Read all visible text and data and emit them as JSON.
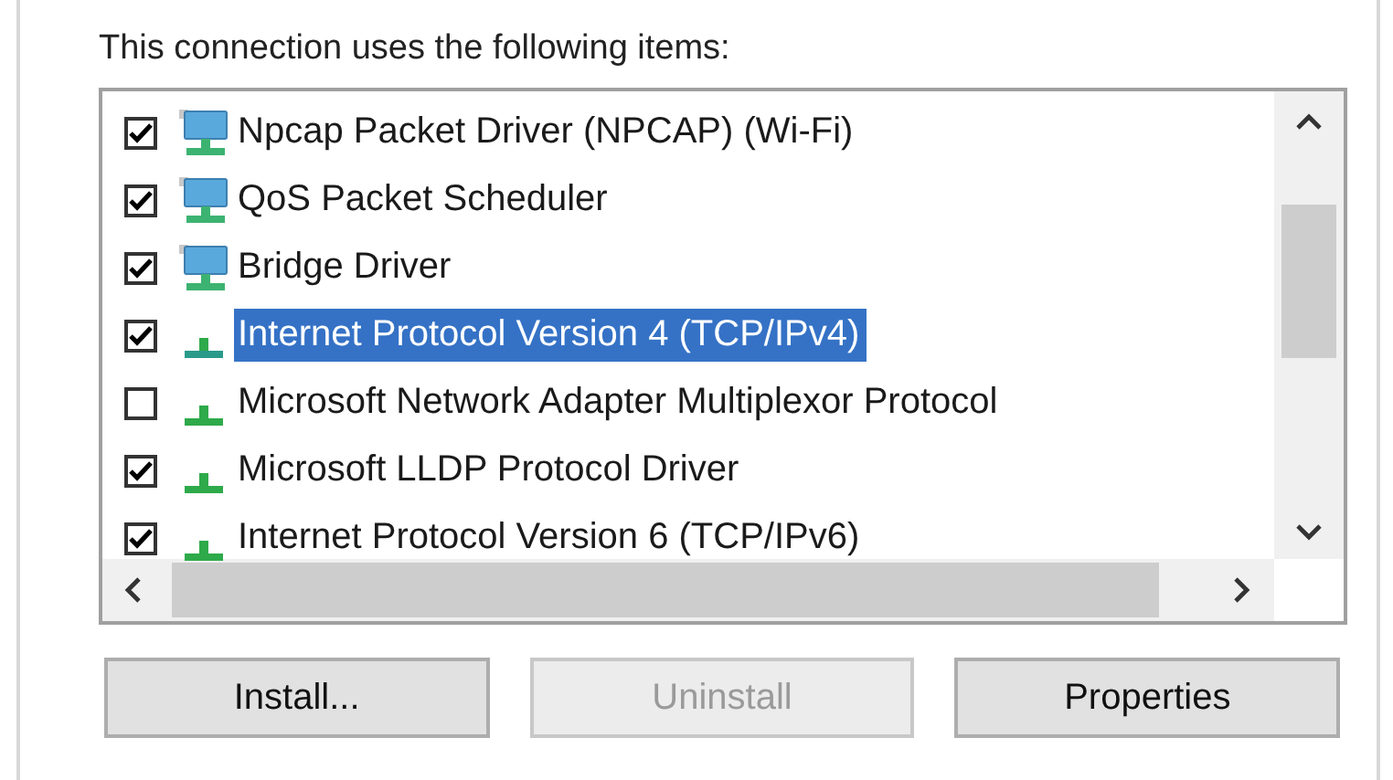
{
  "heading": "This connection uses the following items:",
  "items": [
    {
      "label": "Npcap Packet Driver (NPCAP) (Wi-Fi)",
      "checked": true,
      "selected": false,
      "kind": "service"
    },
    {
      "label": "QoS Packet Scheduler",
      "checked": true,
      "selected": false,
      "kind": "service"
    },
    {
      "label": "Bridge Driver",
      "checked": true,
      "selected": false,
      "kind": "service"
    },
    {
      "label": "Internet Protocol Version 4 (TCP/IPv4)",
      "checked": true,
      "selected": true,
      "kind": "protocol"
    },
    {
      "label": "Microsoft Network Adapter Multiplexor Protocol",
      "checked": false,
      "selected": false,
      "kind": "protocol"
    },
    {
      "label": "Microsoft LLDP Protocol Driver",
      "checked": true,
      "selected": false,
      "kind": "protocol"
    },
    {
      "label": "Internet Protocol Version 6 (TCP/IPv6)",
      "checked": true,
      "selected": false,
      "kind": "protocol"
    }
  ],
  "buttons": [
    {
      "label": "Install...",
      "disabled": false
    },
    {
      "label": "Uninstall",
      "disabled": true
    },
    {
      "label": "Properties",
      "disabled": false
    }
  ]
}
